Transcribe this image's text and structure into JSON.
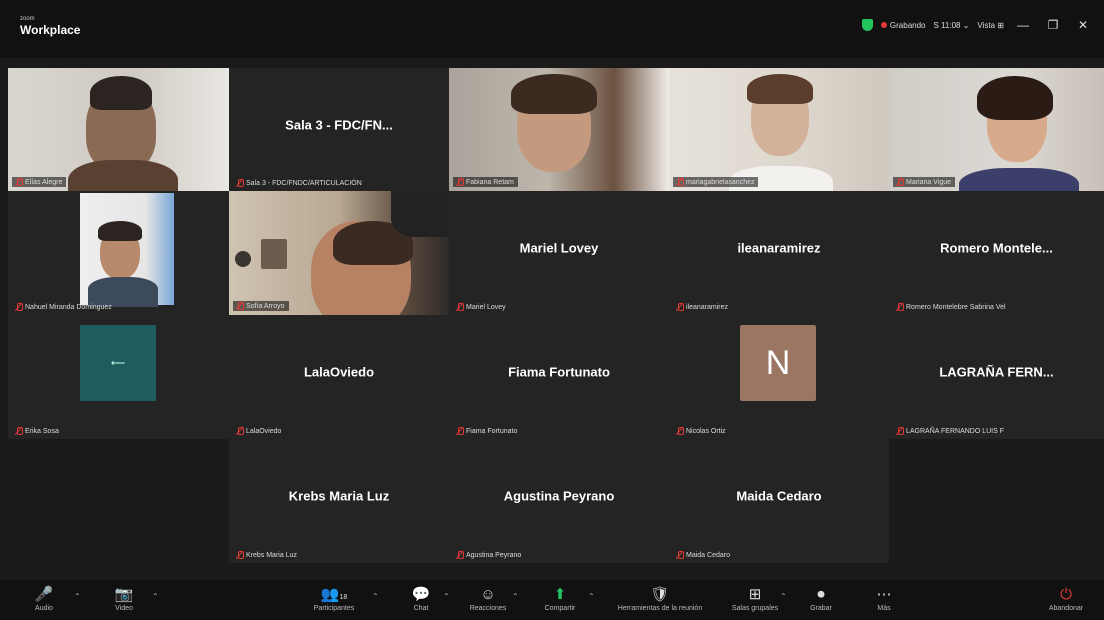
{
  "app": {
    "brand_small": "zoom",
    "brand_big": "Workplace"
  },
  "topbar": {
    "recording_label": "Grabando",
    "sync_label": "S 11:08 ⌄",
    "view_label": "Vista ⊞",
    "minimize": "—",
    "restore": "❐",
    "close": "✕"
  },
  "tiles": [
    {
      "name": "Elías Alegre",
      "big_name": "",
      "type": "video",
      "active": true
    },
    {
      "name": "Sala 3 - FDC/FNDC/ARTICULACIÓN",
      "big_name": "Sala 3 - FDC/FN...",
      "type": "name"
    },
    {
      "name": "Fabiana Retam",
      "big_name": "",
      "type": "video"
    },
    {
      "name": "mariagabrielasanchez",
      "big_name": "",
      "type": "video"
    },
    {
      "name": "Mariana Vigue",
      "big_name": "",
      "type": "video"
    },
    {
      "name": "Nahuel Miranda Dominguez",
      "big_name": "",
      "type": "video-small"
    },
    {
      "name": "Sofía Arroyo",
      "big_name": "",
      "type": "video"
    },
    {
      "name": "Mariel Lovey",
      "big_name": "Mariel Lovey",
      "type": "name"
    },
    {
      "name": "ileanaramirez",
      "big_name": "ileanaramirez",
      "type": "name"
    },
    {
      "name": "Romero Montelebre Sabrina Vel",
      "big_name": "Romero Montele...",
      "type": "name"
    },
    {
      "name": "Erika Sosa",
      "big_name": "",
      "type": "avatar-teal"
    },
    {
      "name": "LalaOviedo",
      "big_name": "LalaOviedo",
      "type": "name"
    },
    {
      "name": "Fiama Fortunato",
      "big_name": "Fiama Fortunato",
      "type": "name"
    },
    {
      "name": "Nicolas Ortiz",
      "big_name": "",
      "type": "avatar-n",
      "avatar_letter": "N"
    },
    {
      "name": "LAGRAÑA FERNANDO LUIS F",
      "big_name": "LAGRAÑA FERN...",
      "type": "name"
    },
    {
      "name": "Krebs Maria Luz",
      "big_name": "Krebs Maria Luz",
      "type": "name"
    },
    {
      "name": "Agustina Peyrano",
      "big_name": "Agustina Peyrano",
      "type": "name"
    },
    {
      "name": "Maida Cedaro",
      "big_name": "Maida Cedaro",
      "type": "name"
    }
  ],
  "avatar_teal_glyph": "⟵",
  "toolbar": [
    {
      "id": "audio",
      "icon": "🎤",
      "label": "Audio",
      "caret": "⌃"
    },
    {
      "id": "video",
      "icon": "📷",
      "label": "Video",
      "caret": "⌃"
    },
    {
      "id": "participants",
      "icon": "👥",
      "label": "Participantes",
      "count": "18",
      "caret": "⌃"
    },
    {
      "id": "chat",
      "icon": "💬",
      "label": "Chat",
      "caret": "⌃"
    },
    {
      "id": "reactions",
      "icon": "☺",
      "label": "Reacciones",
      "caret": "⌃"
    },
    {
      "id": "share",
      "icon": "⬆",
      "label": "Compartir",
      "caret": "⌃"
    },
    {
      "id": "support",
      "icon": "🛡",
      "label": "Herramientas de la reunión"
    },
    {
      "id": "rooms",
      "icon": "⊞",
      "label": "Salas grupales",
      "caret": "⌃"
    },
    {
      "id": "record",
      "icon": "⏺",
      "label": "Grabar"
    },
    {
      "id": "more",
      "icon": "⋯",
      "label": "Más"
    },
    {
      "id": "leave",
      "icon": "⏻",
      "label": "Abandonar"
    }
  ],
  "colors": {
    "active_border": "#23d18b",
    "tile_bg": "#242424",
    "avatar_n": "#9a7663",
    "avatar_teal": "#1d5c5f"
  }
}
